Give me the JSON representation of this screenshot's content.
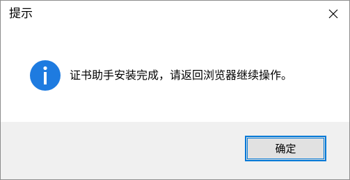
{
  "window": {
    "title": "提示",
    "close_icon": "close-icon"
  },
  "content": {
    "icon": "info-icon",
    "icon_color": "#1e7be0",
    "message": "证书助手安装完成，请返回浏览器继续操作。"
  },
  "footer": {
    "ok_label": "确定",
    "accent": "#0078d7"
  }
}
